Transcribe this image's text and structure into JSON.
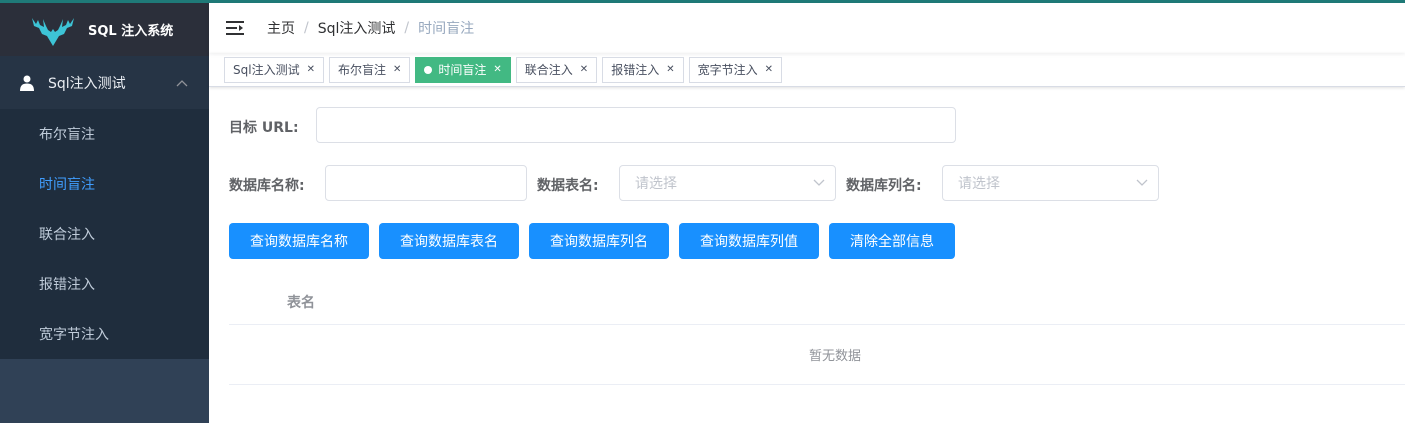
{
  "colors": {
    "accent": "#1890ff",
    "active_tag": "#42b983",
    "sidebar_bg": "#304156",
    "active_menu": "#409eff"
  },
  "sidebar": {
    "logo_title": "SQL 注入系统",
    "group_label": "Sql注入测试",
    "items": [
      {
        "label": "布尔盲注"
      },
      {
        "label": "时间盲注"
      },
      {
        "label": "联合注入"
      },
      {
        "label": "报错注入"
      },
      {
        "label": "宽字节注入"
      }
    ]
  },
  "breadcrumb": [
    "主页",
    "Sql注入测试",
    "时间盲注"
  ],
  "tags": [
    {
      "label": "Sql注入测试"
    },
    {
      "label": "布尔盲注"
    },
    {
      "label": "时间盲注",
      "active": true
    },
    {
      "label": "联合注入"
    },
    {
      "label": "报错注入"
    },
    {
      "label": "宽字节注入"
    }
  ],
  "form": {
    "url_label": "目标 URL:",
    "url_value": "",
    "db_name_label": "数据库名称:",
    "db_name_value": "",
    "table_label": "数据表名:",
    "table_placeholder": "请选择",
    "column_label": "数据库列名:",
    "column_placeholder": "请选择"
  },
  "buttons": [
    {
      "label": "查询数据库名称"
    },
    {
      "label": "查询数据库表名"
    },
    {
      "label": "查询数据库列名"
    },
    {
      "label": "查询数据库列值"
    },
    {
      "label": "清除全部信息"
    }
  ],
  "table": {
    "header": "表名",
    "empty_text": "暂无数据"
  }
}
